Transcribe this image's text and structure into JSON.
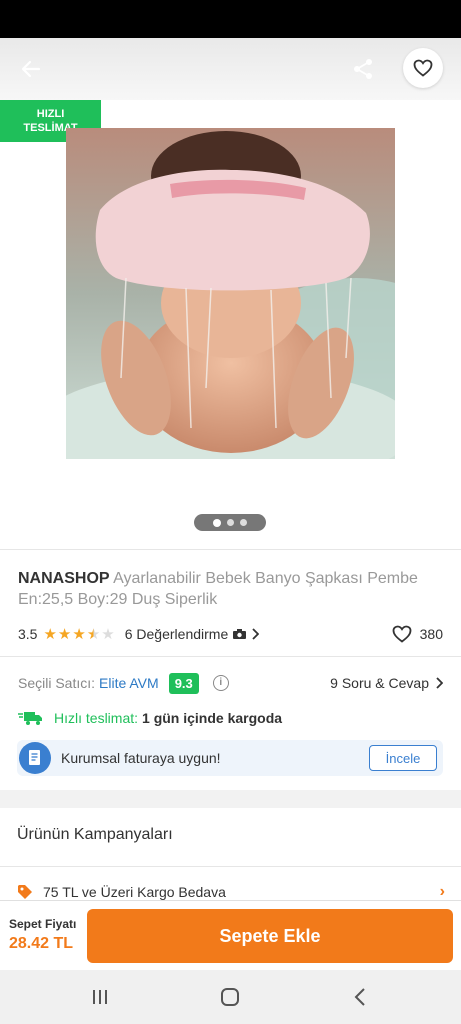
{
  "badge": {
    "line1": "HIZLI",
    "line2": "TESLİMAT"
  },
  "product": {
    "brand": "NANASHOP",
    "name": "Ayarlanabilir Bebek Banyo Şapkası Pembe En:25,5 Boy:29 Duş Siperlik",
    "rating": "3.5",
    "rating_value": 3.5,
    "reviews": "6 Değerlendirme",
    "likes": "380"
  },
  "gallery": {
    "image_count": 3,
    "active_index": 0
  },
  "seller": {
    "label": "Seçili Satıcı:",
    "name": "Elite AVM",
    "score": "9.3",
    "qa": "9 Soru & Cevap"
  },
  "delivery": {
    "label": "Hızlı teslimat:",
    "text": "1 gün içinde kargoda"
  },
  "invoice": {
    "text": "Kurumsal faturaya uygun!",
    "button": "İncele"
  },
  "campaigns": {
    "title": "Ürünün Kampanyaları",
    "items": [
      {
        "text": "75 TL ve Üzeri Kargo Bedava"
      }
    ]
  },
  "cart": {
    "price_label": "Sepet Fiyatı",
    "price": "28.42 TL",
    "button": "Sepete Ekle"
  },
  "colors": {
    "accent": "#f27a1a",
    "green": "#1fbf5a",
    "blue": "#2d7ac5",
    "star": "#f5a623"
  },
  "icons": {
    "back": "arrow-left-icon",
    "share": "share-icon",
    "favorite": "heart-icon",
    "camera": "camera-icon",
    "truck": "truck-icon",
    "invoice": "document-icon",
    "tag": "tag-icon",
    "info": "info-icon"
  }
}
